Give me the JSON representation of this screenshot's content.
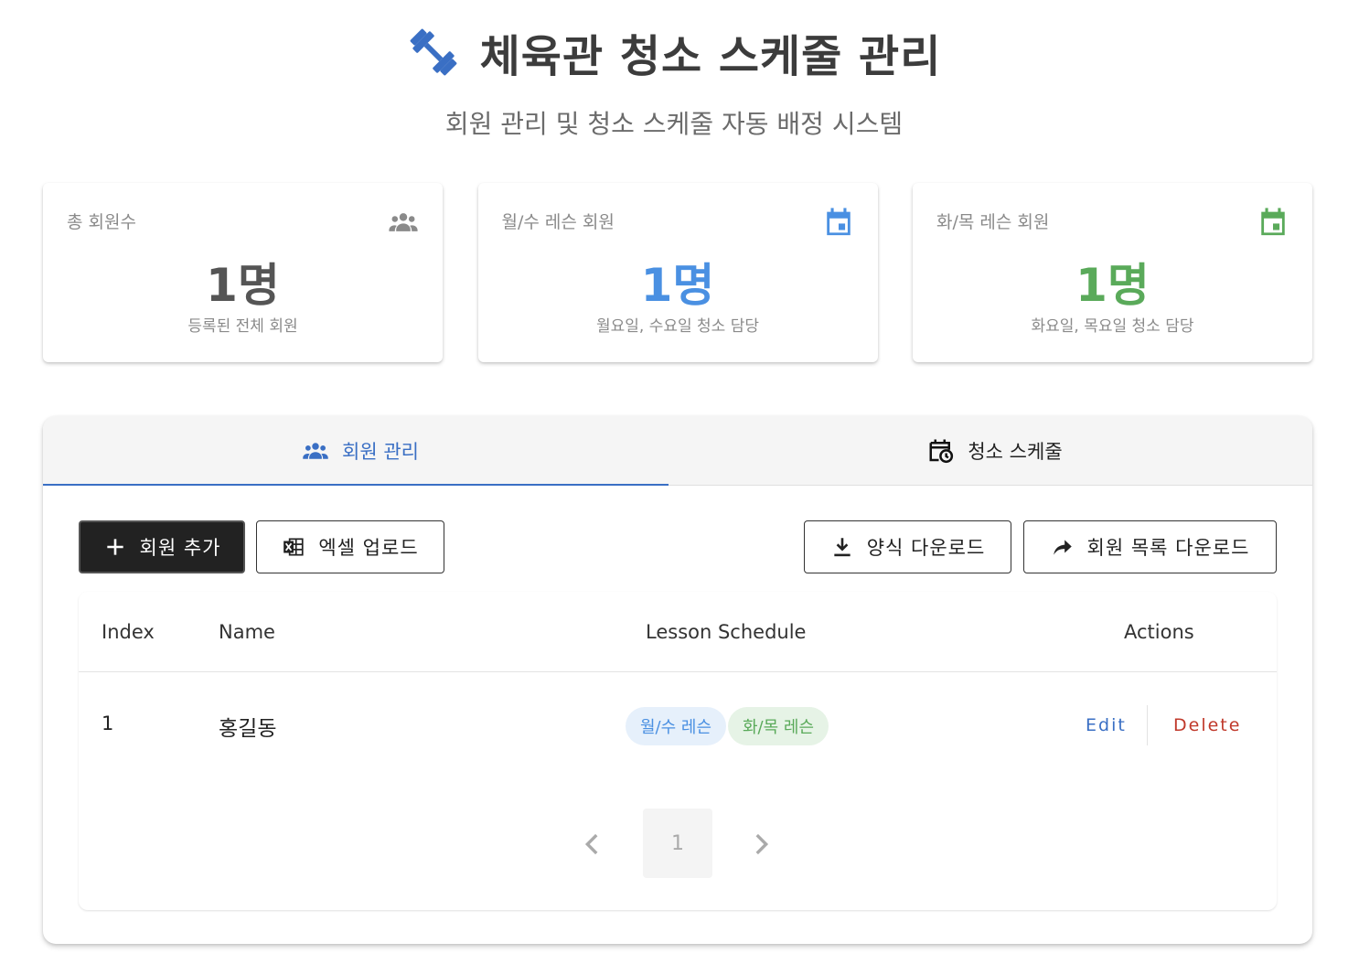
{
  "header": {
    "title": "체육관 청소 스케줄 관리",
    "subtitle": "회원 관리 및 청소 스케줄 자동 배정 시스템",
    "icon": "dumbbell-icon"
  },
  "cards": [
    {
      "label": "총 회원수",
      "value": "1명",
      "desc": "등록된 전체 회원",
      "icon": "group-icon",
      "color": "#555555"
    },
    {
      "label": "월/수 레슨 회원",
      "value": "1명",
      "desc": "월요일, 수요일 청소 담당",
      "icon": "calendar-icon",
      "color": "#4a90e2"
    },
    {
      "label": "화/목 레슨 회원",
      "value": "1명",
      "desc": "화요일, 목요일 청소 담당",
      "icon": "calendar-icon",
      "color": "#5aaa5a"
    }
  ],
  "tabs": [
    {
      "label": "회원 관리",
      "icon": "group-icon",
      "active": true
    },
    {
      "label": "청소 스케줄",
      "icon": "calendar-clock-icon",
      "active": false
    }
  ],
  "toolbar": {
    "add_member": "회원 추가",
    "excel_upload": "엑셀 업로드",
    "template_download": "양식 다운로드",
    "list_download": "회원 목록 다운로드"
  },
  "table": {
    "headers": [
      "Index",
      "Name",
      "Lesson Schedule",
      "Actions"
    ],
    "rows": [
      {
        "index": "1",
        "name": "홍길동",
        "chips": [
          "월/수 레슨",
          "화/목 레슨"
        ],
        "edit": "Edit",
        "delete": "Delete"
      }
    ]
  },
  "pagination": {
    "current": "1"
  },
  "colors": {
    "accent": "#3a6fc4",
    "mw": "#4a90e2",
    "tt": "#5aaa5a",
    "chip_mw_bg": "#e6f0fb",
    "chip_tt_bg": "#e6f3e6",
    "delete": "#c0392b"
  }
}
